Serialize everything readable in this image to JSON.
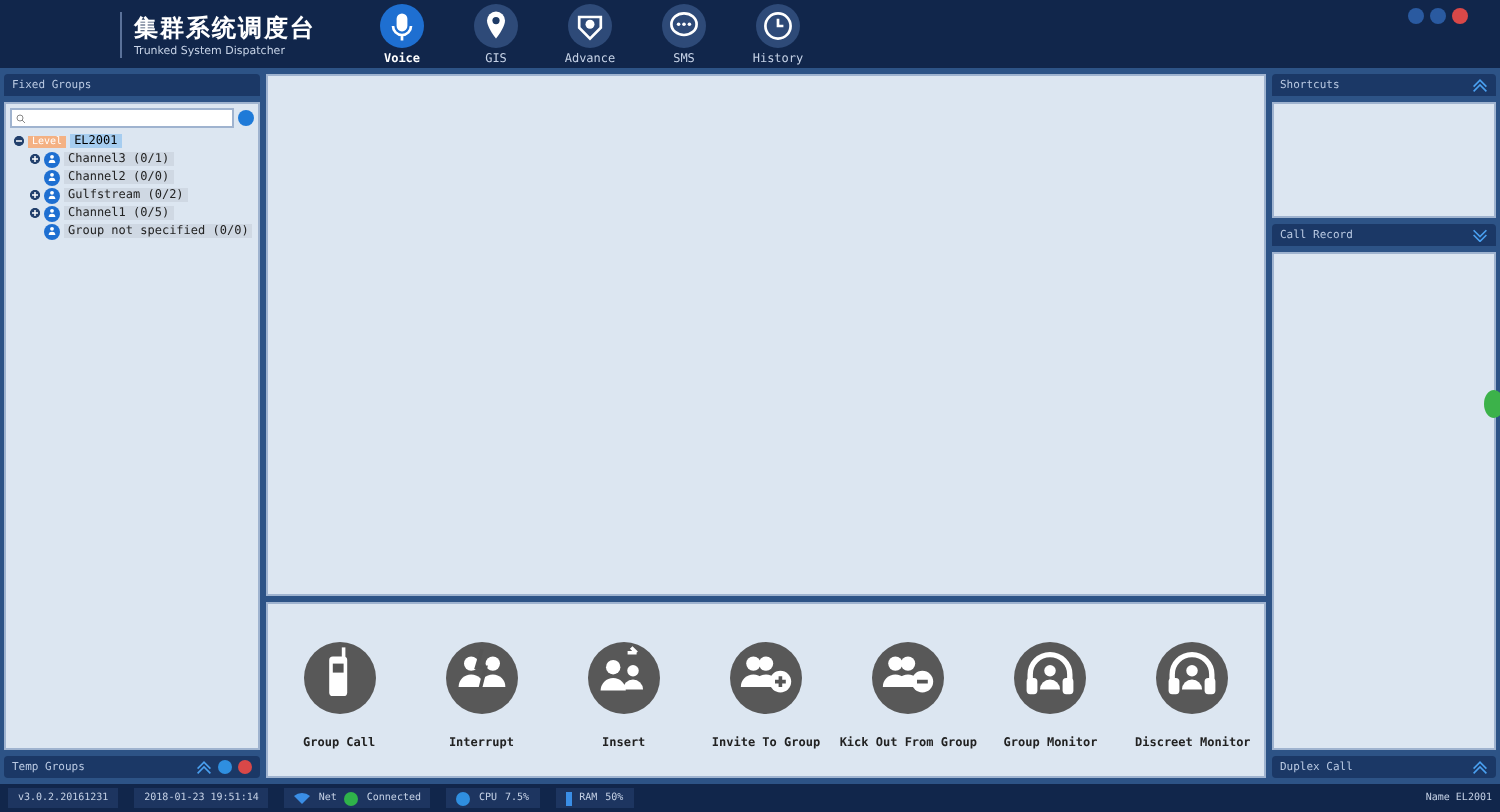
{
  "app": {
    "title": "集群系统调度台",
    "subtitle": "Trunked System Dispatcher"
  },
  "nav": [
    {
      "label": "Voice",
      "selected": true
    },
    {
      "label": "GIS",
      "selected": false
    },
    {
      "label": "Advance",
      "selected": false
    },
    {
      "label": "SMS",
      "selected": false
    },
    {
      "label": "History",
      "selected": false
    }
  ],
  "fixed_groups": {
    "title": "Fixed Groups",
    "tree": {
      "tag": "Level",
      "label": "EL2001",
      "expanded": true,
      "selected": true,
      "children": [
        {
          "label": "Channel3 (0/1)",
          "expandable": true,
          "selected": false
        },
        {
          "label": "Channel2 (0/0)",
          "expandable": false,
          "selected": false
        },
        {
          "label": "Gulfstream (0/2)",
          "expandable": true,
          "selected": false
        },
        {
          "label": "Channel1 (0/5)",
          "expandable": true,
          "selected": false
        },
        {
          "label": "Group not specified (0/0)",
          "expandable": false,
          "selected": false
        }
      ]
    }
  },
  "temp_groups": {
    "title": "Temp Groups"
  },
  "actions": [
    {
      "label": "Group Call"
    },
    {
      "label": "Interrupt"
    },
    {
      "label": "Insert"
    },
    {
      "label": "Invite To Group"
    },
    {
      "label": "Kick Out From Group"
    },
    {
      "label": "Group Monitor"
    },
    {
      "label": "Discreet Monitor"
    }
  ],
  "right": {
    "shortcuts": "Shortcuts",
    "call_record": "Call Record",
    "duplex_call": "Duplex Call"
  },
  "status_bar": {
    "version": "v3.0.2.20161231",
    "datetime": "2018-01-23 19:51:14",
    "net_label": "Net",
    "net_status": "Connected",
    "cpu_label": "CPU",
    "cpu_value": "7.5%",
    "ram_label": "RAM",
    "ram_value": "50%",
    "name": "Name EL2001"
  }
}
